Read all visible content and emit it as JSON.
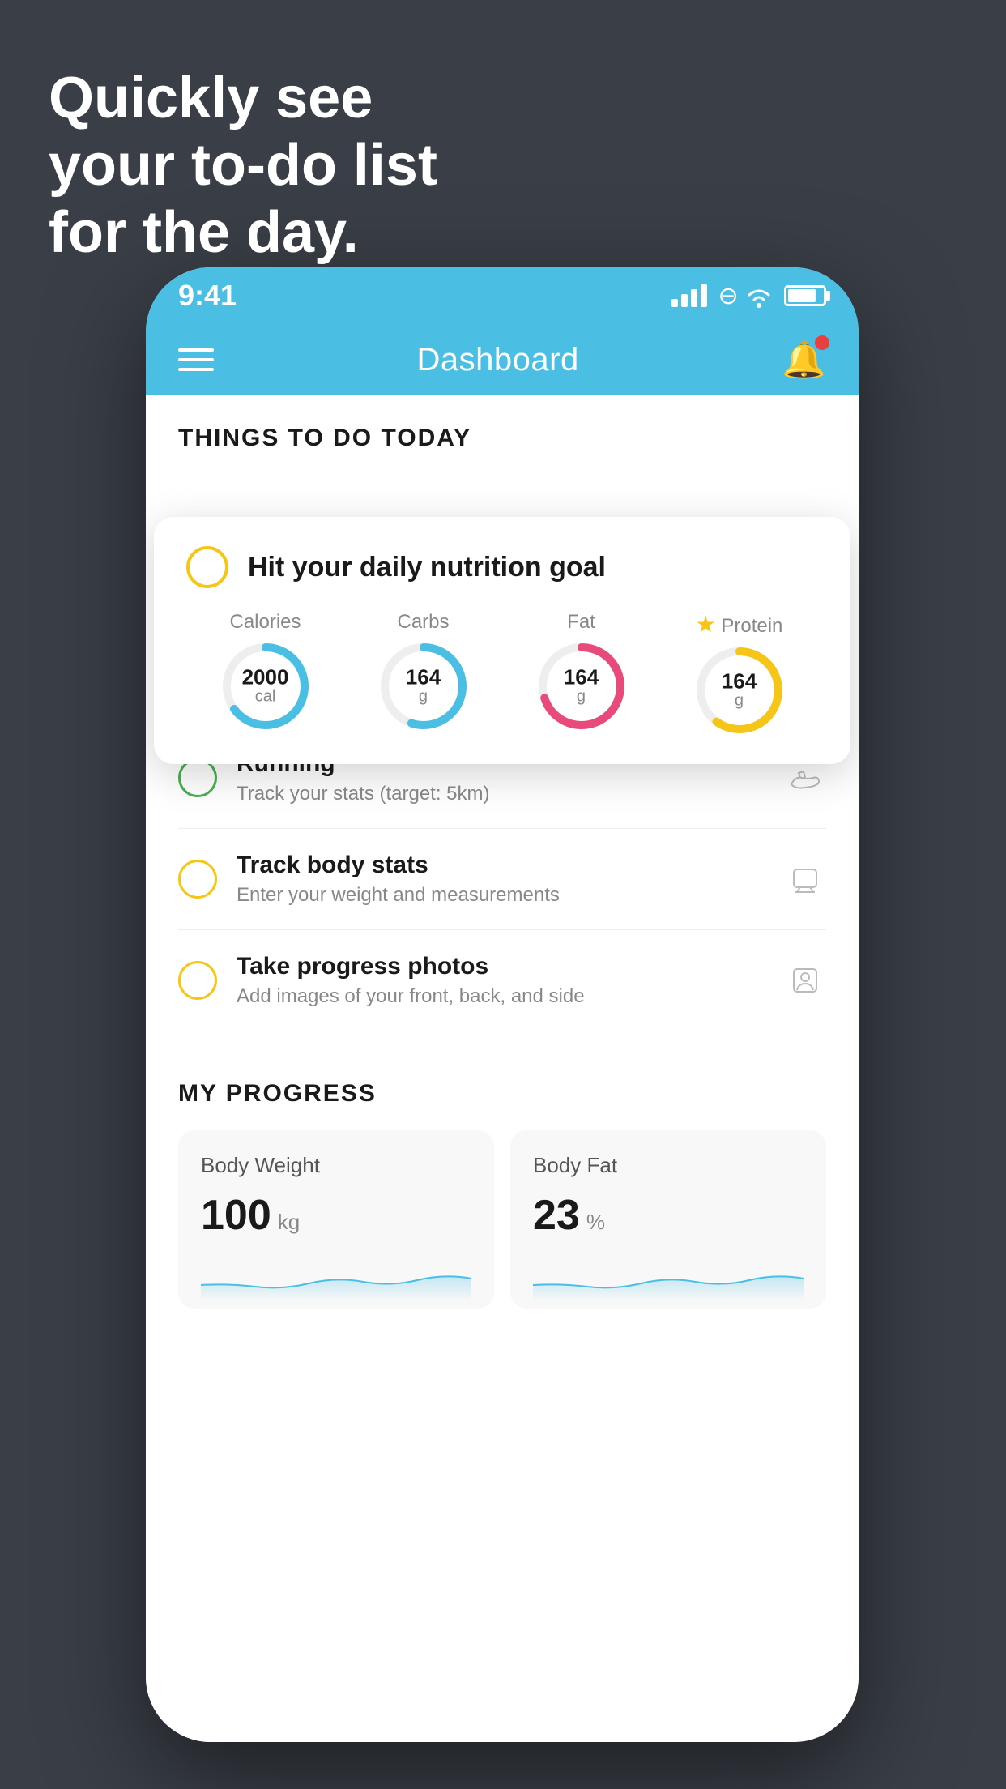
{
  "hero": {
    "line1": "Quickly see",
    "line2": "your to-do list",
    "line3": "for the day."
  },
  "phone": {
    "status_bar": {
      "time": "9:41"
    },
    "nav": {
      "title": "Dashboard"
    },
    "things_section": {
      "heading": "THINGS TO DO TODAY"
    },
    "floating_card": {
      "title": "Hit your daily nutrition goal",
      "nutrition": [
        {
          "label": "Calories",
          "value": "2000",
          "unit": "cal",
          "color": "#4bbee3",
          "pct": 65,
          "starred": false
        },
        {
          "label": "Carbs",
          "value": "164",
          "unit": "g",
          "color": "#4bbee3",
          "pct": 55,
          "starred": false
        },
        {
          "label": "Fat",
          "value": "164",
          "unit": "g",
          "color": "#e84a7c",
          "pct": 70,
          "starred": false
        },
        {
          "label": "Protein",
          "value": "164",
          "unit": "g",
          "color": "#f5c518",
          "pct": 60,
          "starred": true
        }
      ]
    },
    "todo_items": [
      {
        "id": "running",
        "circle_color": "green",
        "title": "Running",
        "subtitle": "Track your stats (target: 5km)",
        "icon": "shoe"
      },
      {
        "id": "body-stats",
        "circle_color": "yellow",
        "title": "Track body stats",
        "subtitle": "Enter your weight and measurements",
        "icon": "scale"
      },
      {
        "id": "progress-photos",
        "circle_color": "yellow",
        "title": "Take progress photos",
        "subtitle": "Add images of your front, back, and side",
        "icon": "person"
      }
    ],
    "progress": {
      "heading": "MY PROGRESS",
      "cards": [
        {
          "id": "body-weight",
          "title": "Body Weight",
          "value": "100",
          "unit": "kg"
        },
        {
          "id": "body-fat",
          "title": "Body Fat",
          "value": "23",
          "unit": "%"
        }
      ]
    }
  }
}
